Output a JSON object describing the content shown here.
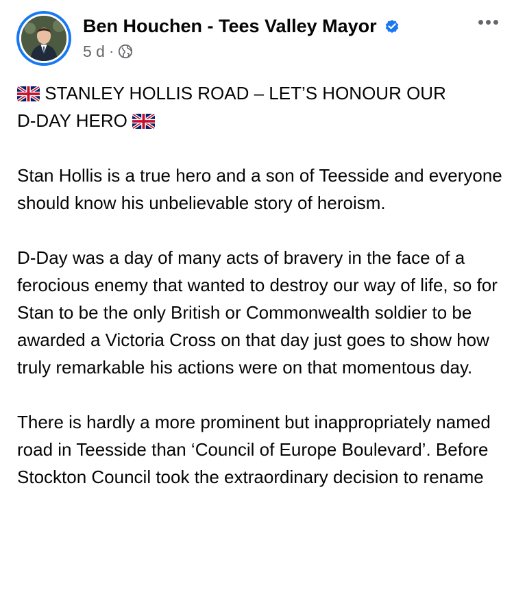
{
  "post": {
    "author": "Ben Houchen - Tees Valley Mayor",
    "verified_icon": "verified-badge-icon",
    "time": "5 d",
    "separator": "·",
    "audience_icon": "globe-icon",
    "more_icon": "more-options-icon",
    "headline": {
      "flag_icon": "uk-flag-icon",
      "line1": "STANLEY HOLLIS ROAD – LET’S HONOUR OUR",
      "line2": "D-DAY HERO"
    },
    "paragraphs": [
      "Stan Hollis is a true hero and a son of Teesside and everyone should know his unbelievable story of heroism.",
      "D-Day was a day of many acts of bravery in the face of a ferocious enemy that wanted to destroy our way of life, so for Stan to be the only British or Commonwealth soldier to be awarded a Victoria Cross on that day just goes to show how truly remarkable his actions were on that momentous day.",
      "There is hardly a more prominent but inappropriately named road in Teesside than ‘Council of Europe Boulevard’. Before Stockton Council took the extraordinary decision to rename"
    ]
  },
  "colors": {
    "text": "#050505",
    "secondary": "#65676b",
    "accent": "#1877f2"
  }
}
